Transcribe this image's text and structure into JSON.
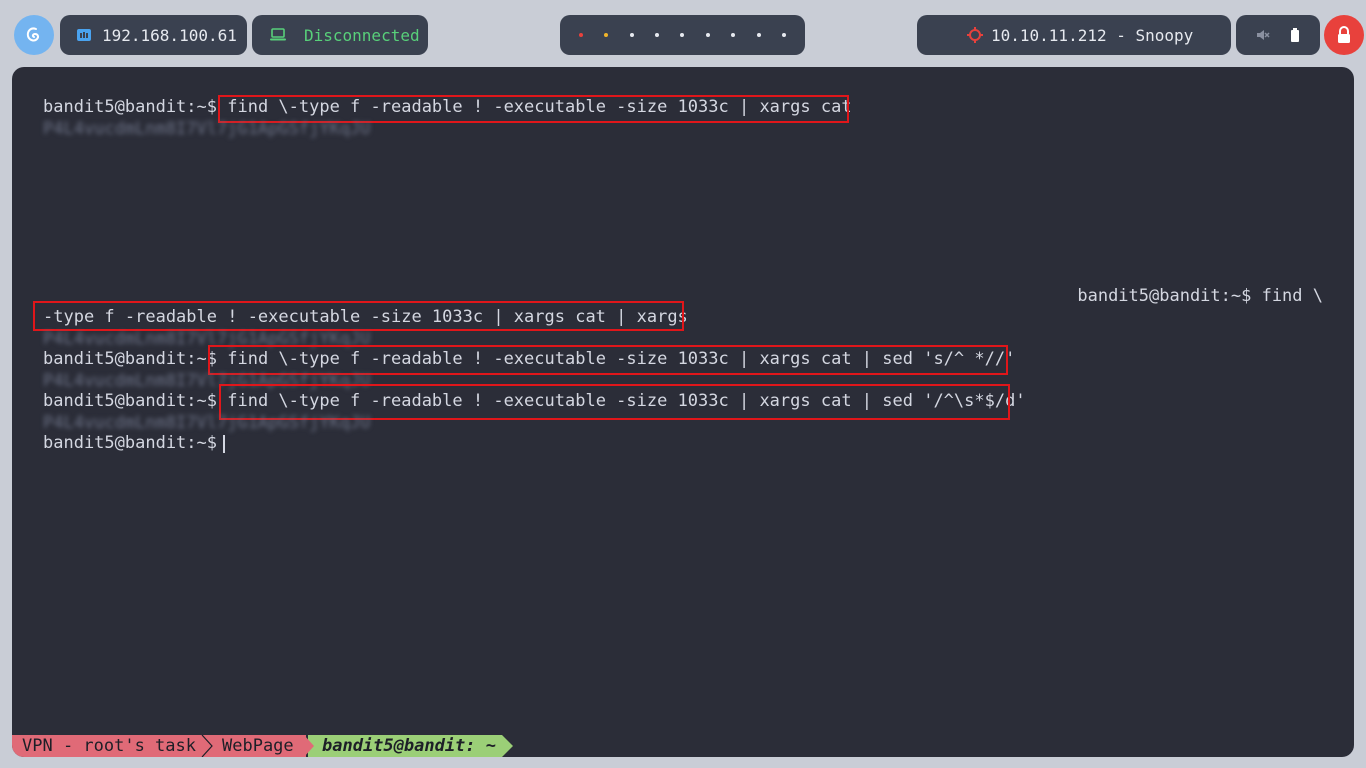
{
  "topbar": {
    "local_ip": "192.168.100.61",
    "vpn_status": "Disconnected",
    "target": "10.10.11.212 - Snoopy",
    "workspace_dot_colors": [
      "#e8413c",
      "#f0b429",
      "#e6e9ef",
      "#e6e9ef",
      "#e6e9ef",
      "#e6e9ef",
      "#e6e9ef",
      "#e6e9ef",
      "#e6e9ef"
    ]
  },
  "terminal": {
    "line1_prompt": "bandit5@bandit:~$ ",
    "line1_cmd": "find \\-type f -readable ! -executable -size 1033c | xargs cat",
    "blurred_output": "P4L4vucdmLnm8I7Vl7jG1ApGSfjYKqJU",
    "line2_right": "bandit5@bandit:~$ find \\",
    "line2_cont": "-type f -readable ! -executable -size 1033c | xargs cat | xargs",
    "line3_prompt": "bandit5@bandit:~$ ",
    "line3_cmd": "find \\-type f -readable ! -executable -size 1033c | xargs cat | sed 's/^ *//'",
    "line4_prompt": "bandit5@bandit:~$ ",
    "line4_cmd": "find \\-type f -readable ! -executable -size 1033c | xargs cat | sed '/^\\s*$/d'",
    "line5_prompt": "bandit5@bandit:~$ "
  },
  "statusline": {
    "segment1": "VPN - root's task",
    "segment2": "WebPage",
    "segment3": "bandit5@bandit: ~"
  },
  "colors": {
    "terminal_bg": "#2b2d38",
    "highlight_box": "#e0161a",
    "vpn_green": "#58d07a",
    "status_pink": "#e06a77",
    "status_green": "#9bcf77"
  }
}
